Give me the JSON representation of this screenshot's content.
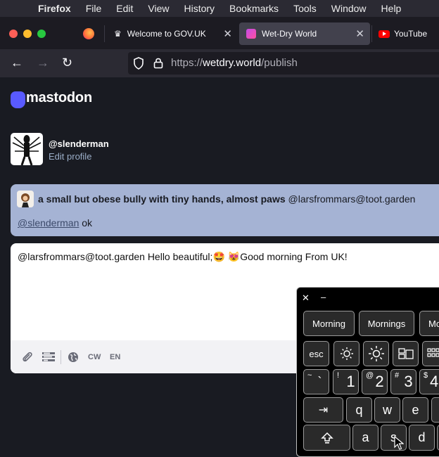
{
  "menubar": {
    "app_name": "Firefox",
    "items": [
      "File",
      "Edit",
      "View",
      "History",
      "Bookmarks",
      "Tools",
      "Window",
      "Help"
    ]
  },
  "tabs": [
    {
      "label": "Welcome to GOV.UK"
    },
    {
      "label": "Wet-Dry World"
    },
    {
      "label": "YouTube"
    }
  ],
  "url": {
    "scheme": "https://",
    "host": "wetdry.world",
    "path": "/publish"
  },
  "mastodon": {
    "logo_text": "mastodon",
    "profile": {
      "handle": "@slenderman",
      "edit_label": "Edit profile"
    },
    "reply_to": {
      "display_name": "a small but obese bully with tiny hands, almost paws",
      "account": "@larsfrommars@toot.garden",
      "mention": "@slenderman",
      "body": " ok"
    },
    "compose": {
      "text_part1": "@larsfrommars@toot.garden Hello beautiful;",
      "emoji1": "🤩",
      "emoji2": "😻",
      "text_part2": "Good morning From UK!",
      "cw_label": "CW",
      "lang_label": "EN"
    }
  },
  "keyboard": {
    "close_glyph": "✕",
    "minimize_glyph": "–",
    "suggestions": [
      "Morning",
      "Mornings",
      "Mo"
    ],
    "esc_label": "esc",
    "number_row": [
      {
        "main": "`",
        "sup": "~"
      },
      {
        "main": "1",
        "sup": "!"
      },
      {
        "main": "2",
        "sup": "@"
      },
      {
        "main": "3",
        "sup": "#"
      },
      {
        "main": "4",
        "sup": "$"
      }
    ],
    "letter_row1": [
      "q",
      "w",
      "e"
    ],
    "letter_row2": [
      "a",
      "s",
      "d"
    ]
  },
  "colors": {
    "accent": "#595aff",
    "reply_bg": "#a5b3d4",
    "url_host": "#fbfbfe",
    "url_dim": "#b0afb8"
  }
}
